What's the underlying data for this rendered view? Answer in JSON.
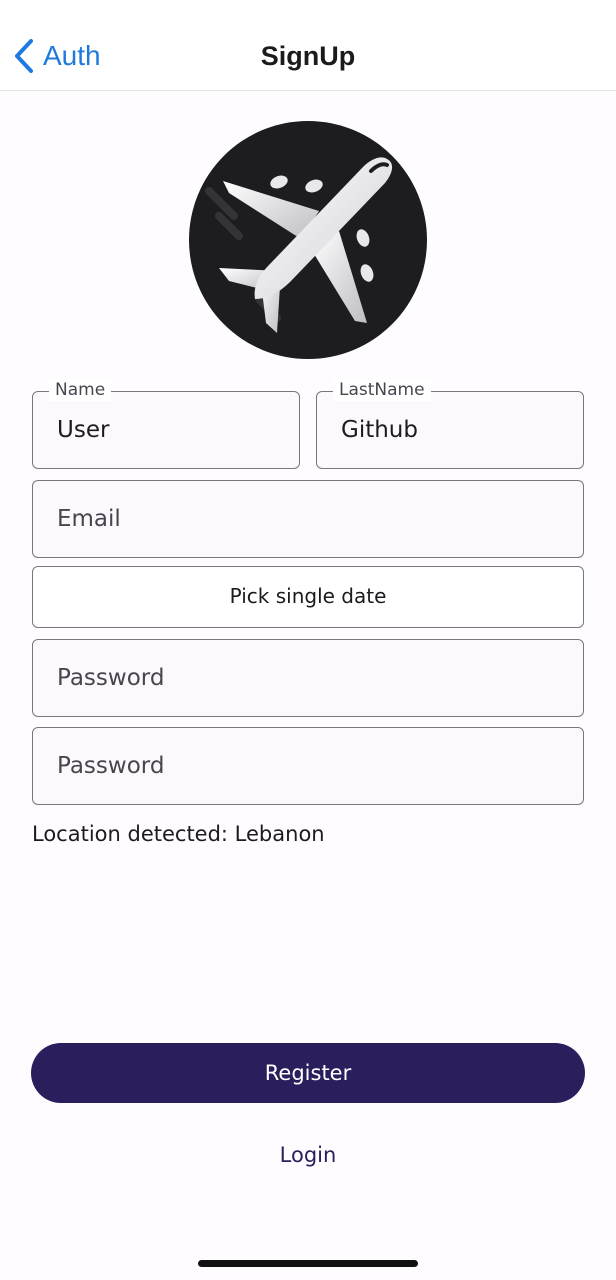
{
  "nav": {
    "back_label": "Auth",
    "title": "SignUp",
    "accent": "#1f7ae0"
  },
  "logo": {
    "icon": "airplane-icon",
    "background": "#1d1d20"
  },
  "form": {
    "name": {
      "label": "Name",
      "value": "User"
    },
    "last_name": {
      "label": "LastName",
      "value": "Github"
    },
    "email": {
      "placeholder": "Email",
      "value": ""
    },
    "date_button": {
      "label": "Pick single date"
    },
    "password": {
      "placeholder": "Password",
      "value": ""
    },
    "confirm_password": {
      "placeholder": "Password",
      "value": ""
    }
  },
  "location_text": "Location detected: Lebanon",
  "actions": {
    "register_label": "Register",
    "login_label": "Login",
    "primary_color": "#2a1f5c"
  }
}
